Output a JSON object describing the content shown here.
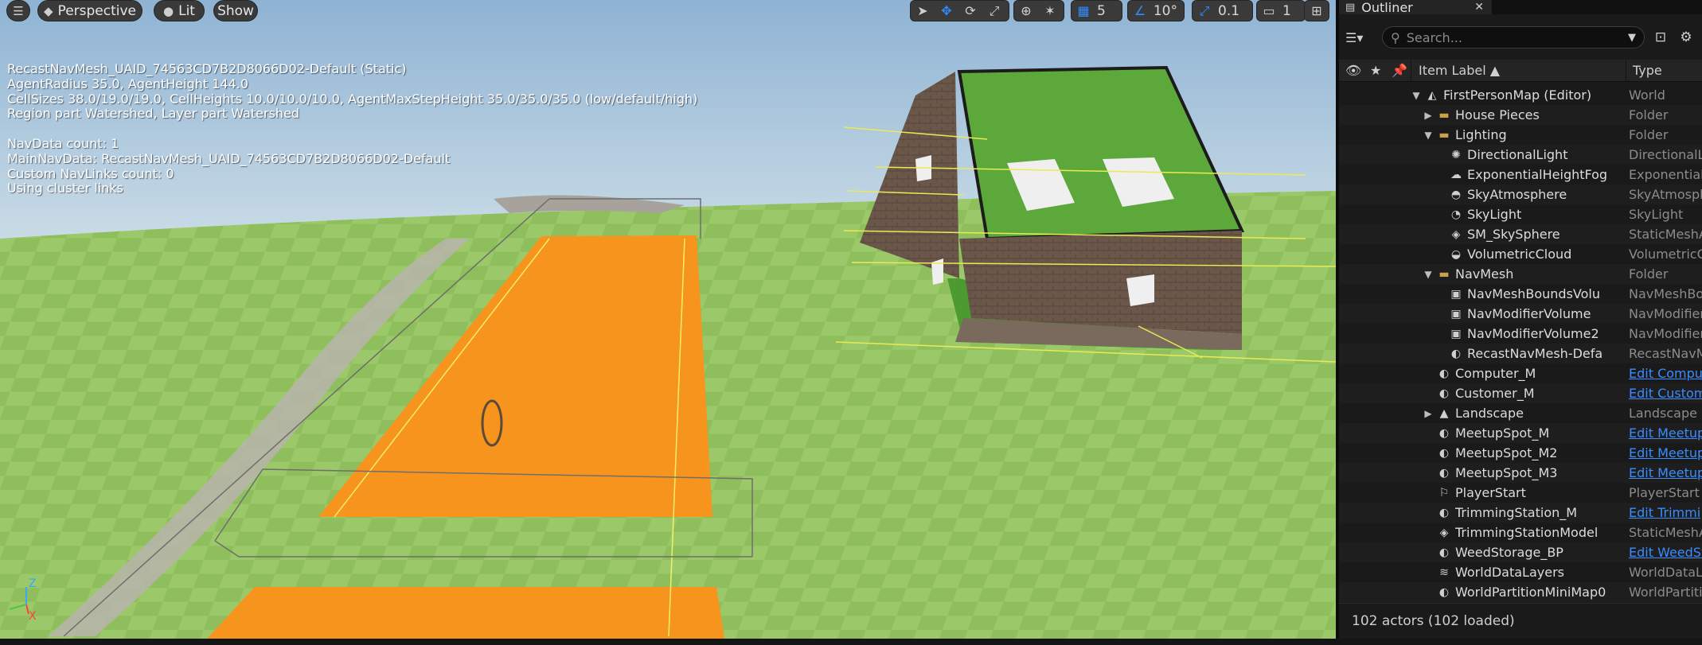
{
  "viewport": {
    "menu_glyph": "☰",
    "perspective_label": "Perspective",
    "lit_label": "Lit",
    "show_label": "Show",
    "snap_grid_value": "5",
    "rotation_snap_value": "10°",
    "scale_snap_value": "0.1",
    "camera_speed_value": "1",
    "axis_labels": {
      "z": "Z",
      "x": "X"
    },
    "debug_lines": [
      "RecastNavMesh_UAID_74563CD7B2D8066D02-Default (Static)",
      "AgentRadius 35.0, AgentHeight 144.0",
      "CellSizes 38.0/19.0/19.0, CellHeights 10.0/10.0/10.0, AgentMaxStepHeight 35.0/35.0/35.0 (low/default/high)",
      "Region part Watershed, Layer part Watershed",
      "",
      "NavData count: 1",
      "MainNavData: RecastNavMesh_UAID_74563CD7B2D8066D02-Default",
      "Custom NavLinks count: 0",
      "Using cluster links"
    ],
    "colors": {
      "navmesh": "#f7941d",
      "grass": "#8fbf5c",
      "sky": "#aac6dc",
      "roof": "#5da83a"
    }
  },
  "outliner": {
    "tab_title": "Outliner",
    "search_placeholder": "Search...",
    "column_label": "Item Label ▲",
    "column_type": "Type",
    "footer": "102 actors (102 loaded)",
    "rows": [
      {
        "label": "FirstPersonMap (Editor)",
        "type": "World",
        "indent": 0,
        "expander": "▼",
        "icon": "world-icon",
        "glyph": "◭",
        "link": false
      },
      {
        "label": "House Pieces",
        "type": "Folder",
        "indent": 1,
        "expander": "▶",
        "icon": "folder-icon",
        "glyph": "▬",
        "link": false
      },
      {
        "label": "Lighting",
        "type": "Folder",
        "indent": 1,
        "expander": "▼",
        "icon": "folder-open-icon",
        "glyph": "▬",
        "link": false
      },
      {
        "label": "DirectionalLight",
        "type": "DirectionalL",
        "indent": 2,
        "expander": "",
        "icon": "sun-icon",
        "glyph": "✺",
        "link": false
      },
      {
        "label": "ExponentialHeightFog",
        "type": "ExponentialH",
        "indent": 2,
        "expander": "",
        "icon": "fog-icon",
        "glyph": "☁",
        "link": false
      },
      {
        "label": "SkyAtmosphere",
        "type": "SkyAtmosph",
        "indent": 2,
        "expander": "",
        "icon": "atmosphere-icon",
        "glyph": "◓",
        "link": false
      },
      {
        "label": "SkyLight",
        "type": "SkyLight",
        "indent": 2,
        "expander": "",
        "icon": "skylight-icon",
        "glyph": "◔",
        "link": false
      },
      {
        "label": "SM_SkySphere",
        "type": "StaticMeshA",
        "indent": 2,
        "expander": "",
        "icon": "static-mesh-icon",
        "glyph": "◈",
        "link": false
      },
      {
        "label": "VolumetricCloud",
        "type": "VolumetricC",
        "indent": 2,
        "expander": "",
        "icon": "cloud-icon",
        "glyph": "◒",
        "link": false
      },
      {
        "label": "NavMesh",
        "type": "Folder",
        "indent": 1,
        "expander": "▼",
        "icon": "folder-open-icon",
        "glyph": "▬",
        "link": false
      },
      {
        "label": "NavMeshBoundsVolu",
        "type": "NavMeshBo",
        "indent": 2,
        "expander": "",
        "icon": "volume-icon",
        "glyph": "▣",
        "link": false
      },
      {
        "label": "NavModifierVolume",
        "type": "NavModifier",
        "indent": 2,
        "expander": "",
        "icon": "volume-icon",
        "glyph": "▣",
        "link": false
      },
      {
        "label": "NavModifierVolume2",
        "type": "NavModifier",
        "indent": 2,
        "expander": "",
        "icon": "volume-icon",
        "glyph": "▣",
        "link": false
      },
      {
        "label": "RecastNavMesh-Defa",
        "type": "RecastNavM",
        "indent": 2,
        "expander": "",
        "icon": "actor-icon",
        "glyph": "◐",
        "link": false
      },
      {
        "label": "Computer_M",
        "type": "Edit Compu",
        "indent": 1,
        "expander": "",
        "icon": "actor-icon",
        "glyph": "◐",
        "link": true
      },
      {
        "label": "Customer_M",
        "type": "Edit Custom",
        "indent": 1,
        "expander": "",
        "icon": "actor-icon",
        "glyph": "◐",
        "link": true
      },
      {
        "label": "Landscape",
        "type": "Landscape",
        "indent": 1,
        "expander": "▶",
        "icon": "landscape-icon",
        "glyph": "▲",
        "link": false
      },
      {
        "label": "MeetupSpot_M",
        "type": "Edit Meetup",
        "indent": 1,
        "expander": "",
        "icon": "actor-icon",
        "glyph": "◐",
        "link": true
      },
      {
        "label": "MeetupSpot_M2",
        "type": "Edit Meetup",
        "indent": 1,
        "expander": "",
        "icon": "actor-icon",
        "glyph": "◐",
        "link": true
      },
      {
        "label": "MeetupSpot_M3",
        "type": "Edit Meetup",
        "indent": 1,
        "expander": "",
        "icon": "actor-icon",
        "glyph": "◐",
        "link": true
      },
      {
        "label": "PlayerStart",
        "type": "PlayerStart",
        "indent": 1,
        "expander": "",
        "icon": "player-start-icon",
        "glyph": "⚐",
        "link": false
      },
      {
        "label": "TrimmingStation_M",
        "type": "Edit Trimmi",
        "indent": 1,
        "expander": "",
        "icon": "actor-icon",
        "glyph": "◐",
        "link": true
      },
      {
        "label": "TrimmingStationModel",
        "type": "StaticMeshA",
        "indent": 1,
        "expander": "",
        "icon": "static-mesh-icon",
        "glyph": "◈",
        "link": false
      },
      {
        "label": "WeedStorage_BP",
        "type": "Edit WeedSt",
        "indent": 1,
        "expander": "",
        "icon": "actor-icon",
        "glyph": "◐",
        "link": true
      },
      {
        "label": "WorldDataLayers",
        "type": "WorldDataLa",
        "indent": 1,
        "expander": "",
        "icon": "layers-icon",
        "glyph": "≋",
        "link": false
      },
      {
        "label": "WorldPartitionMiniMap0",
        "type": "WorldPartiti",
        "indent": 1,
        "expander": "",
        "icon": "actor-icon",
        "glyph": "◐",
        "link": false
      }
    ]
  }
}
